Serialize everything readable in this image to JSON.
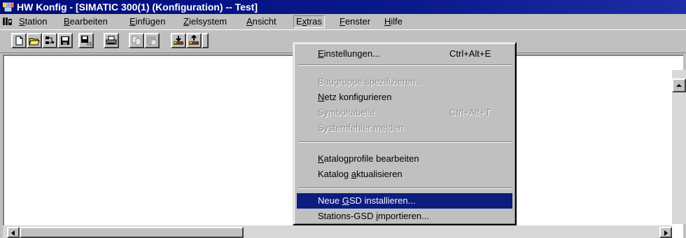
{
  "window": {
    "title": "HW Konfig - [SIMATIC 300(1) (Konfiguration) -- Test]"
  },
  "menubar": {
    "items": [
      {
        "pre": "",
        "u": "S",
        "post": "tation"
      },
      {
        "pre": "",
        "u": "B",
        "post": "earbeiten"
      },
      {
        "pre": "",
        "u": "E",
        "post": "infügen"
      },
      {
        "pre": "",
        "u": "Z",
        "post": "ielsystem"
      },
      {
        "pre": "",
        "u": "A",
        "post": "nsicht"
      },
      {
        "pre": "E",
        "u": "x",
        "post": "tras"
      },
      {
        "pre": "",
        "u": "F",
        "post": "enster"
      },
      {
        "pre": "",
        "u": "H",
        "post": "ilfe"
      }
    ]
  },
  "extras_menu": {
    "items": [
      {
        "pre": "",
        "u": "E",
        "post": "instellungen...",
        "shortcut": "Ctrl+Alt+E",
        "disabled": false
      },
      {
        "pre": "Baugruppe spezifizieren...",
        "u": "",
        "post": "",
        "shortcut": "",
        "disabled": true
      },
      {
        "pre": "",
        "u": "N",
        "post": "etz konfigurieren",
        "shortcut": "",
        "disabled": false
      },
      {
        "pre": "Symboltabelle",
        "u": "",
        "post": "",
        "shortcut": "Ctrl+Alt+T",
        "disabled": true
      },
      {
        "pre": "Systemfehler melden",
        "u": "",
        "post": "",
        "shortcut": "",
        "disabled": true
      },
      {
        "pre": "",
        "u": "K",
        "post": "atalogprofile bearbeiten",
        "shortcut": "",
        "disabled": false
      },
      {
        "pre": "Katalog ",
        "u": "a",
        "post": "ktualisieren",
        "shortcut": "",
        "disabled": false
      },
      {
        "pre": "Neue ",
        "u": "G",
        "post": "SD installieren...",
        "shortcut": "",
        "disabled": false,
        "highlighted": true
      },
      {
        "pre": "Stations-GSD ",
        "u": "i",
        "post": "mportieren...",
        "shortcut": "",
        "disabled": false
      }
    ]
  },
  "colors": {
    "title_bar": "#0a1a8c",
    "highlight": "#0c1d7e",
    "face": "#c0c0c0"
  },
  "toolbar_icons": [
    "new-icon",
    "open-icon",
    "accessible-nodes-icon",
    "save-icon",
    "save-compile-icon",
    "print-icon",
    "copy-icon",
    "paste-icon",
    "download-icon",
    "upload-icon"
  ]
}
